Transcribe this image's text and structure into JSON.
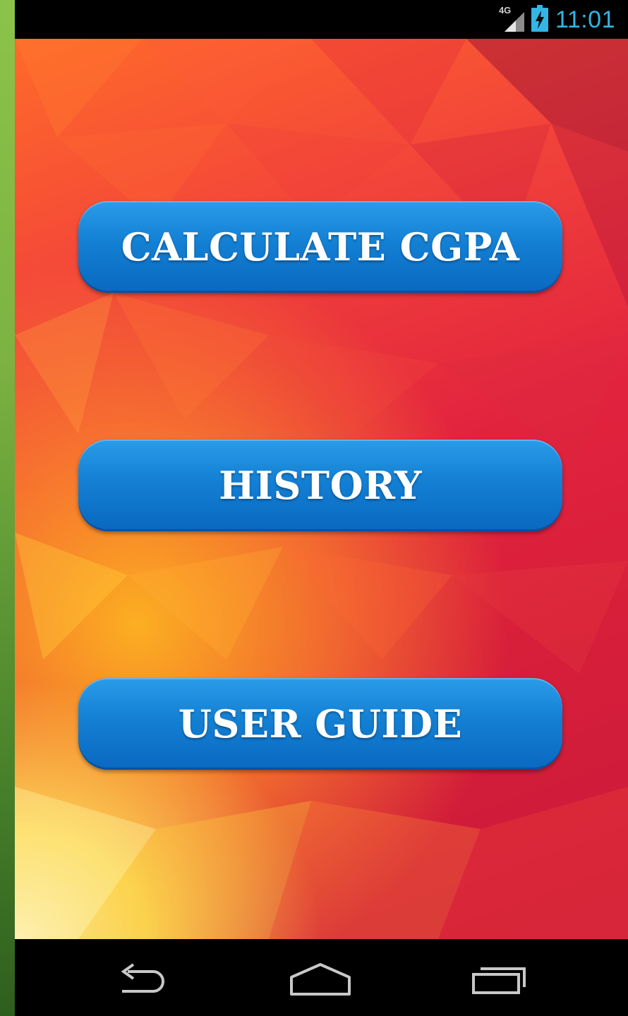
{
  "status_bar": {
    "network": "4G",
    "time": "11:01",
    "icons": [
      "signal-icon",
      "battery-charging-icon"
    ],
    "clock_color": "#33b5e5"
  },
  "menu": {
    "calculate_label": "CALCULATE CGPA",
    "history_label": "HISTORY",
    "user_guide_label": "USER GUIDE",
    "button_color": "#1380d4"
  },
  "nav_bar": {
    "icons": [
      "back-icon",
      "home-icon",
      "recents-icon"
    ]
  }
}
